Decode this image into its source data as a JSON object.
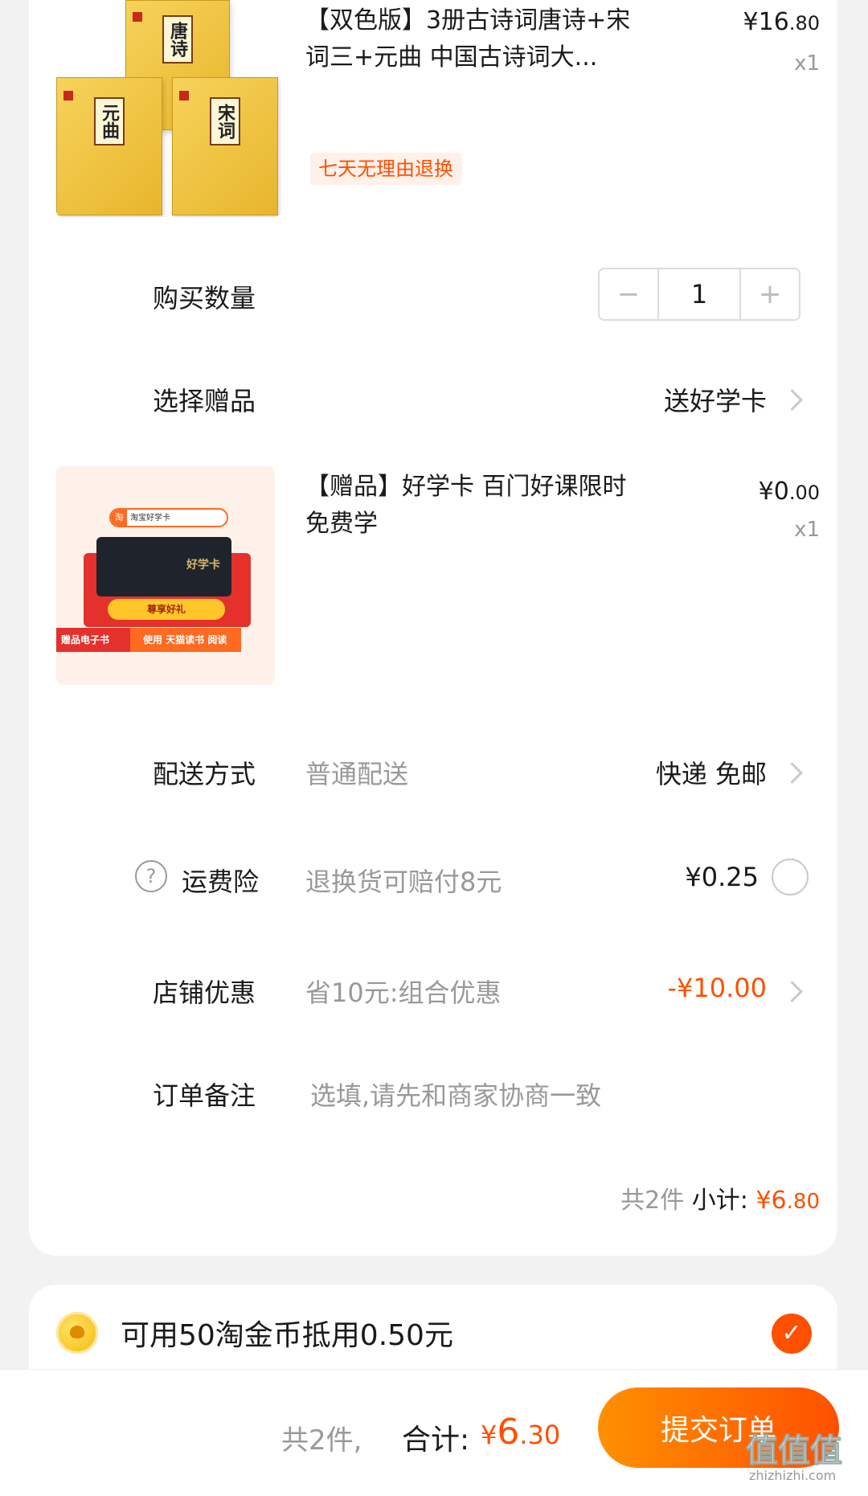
{
  "product": {
    "title_line1": "【双色版】3册古诗词唐诗+宋",
    "title_line2": "词三+元曲 中国古诗词大...",
    "price_symbol": "¥",
    "price_int": "16",
    "price_dec": ".80",
    "quantity_label": "x1",
    "return_tag": "七天无理由退换",
    "book_titles": [
      "唐诗",
      "元曲",
      "宋词"
    ]
  },
  "quantity_row": {
    "label": "购买数量",
    "minus": "−",
    "value": "1",
    "plus": "+"
  },
  "gift_row": {
    "label": "选择赠品",
    "value": "送好学卡"
  },
  "gift": {
    "title_line1": "【赠品】好学卡 百门好课限时",
    "title_line2": "免费学",
    "price_symbol": "¥",
    "price_int": "0",
    "price_dec": ".00",
    "quantity_label": "x1",
    "image_text": {
      "search_logo": "淘",
      "search_text": "淘宝好学卡",
      "card_title": "好学卡",
      "button": "尊享好礼",
      "banner_left": "赠品电子书",
      "banner_right": "使用 天猫读书 阅读"
    }
  },
  "shipping": {
    "label": "配送方式",
    "sub": "普通配送",
    "value": "快递 免邮"
  },
  "insurance": {
    "label": "运费险",
    "sub": "退换货可赔付8元",
    "value": "¥0.25"
  },
  "store_discount": {
    "label": "店铺优惠",
    "sub": "省10元:组合优惠",
    "value": "-¥10.00"
  },
  "note": {
    "label": "订单备注",
    "placeholder": "选填,请先和商家协商一致"
  },
  "subtotal": {
    "count": "共2件",
    "label": "小计:",
    "symbol": "¥",
    "int": "6",
    "dec": ".80"
  },
  "coins": {
    "text": "可用50淘金币抵用0.50元"
  },
  "bottom_bar": {
    "count": "共2件,",
    "total_label": "合计:",
    "total_symbol": "¥",
    "total_int": "6",
    "total_dec": ".30",
    "submit": "提交订单"
  },
  "watermark": {
    "text": "值值值",
    "domain": "zhizhizhi.com"
  },
  "colors": {
    "accent": "#ff5000",
    "accent_gradient_start": "#ff9000",
    "background": "#f2f2f2"
  }
}
